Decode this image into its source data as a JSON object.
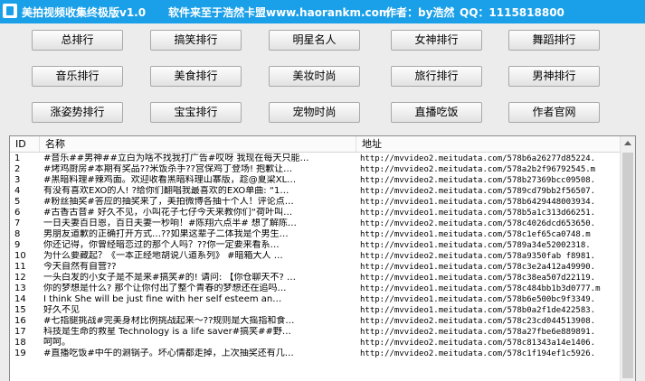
{
  "window": {
    "title_app": "美拍视频收集终极版v1.0",
    "title_source": "软件来至于浩然卡盟www.haorankm.com",
    "title_author": "作者：by浩然",
    "title_qq": "QQ：1115818800"
  },
  "buttons": [
    [
      "总排行",
      "搞笑排行",
      "明星名人",
      "女神排行",
      "舞蹈排行"
    ],
    [
      "音乐排行",
      "美食排行",
      "美妆时尚",
      "旅行排行",
      "男神排行"
    ],
    [
      "涨姿势排行",
      "宝宝排行",
      "宠物时尚",
      "直播吃饭",
      "作者官网"
    ]
  ],
  "list": {
    "columns": {
      "id": "ID",
      "name": "名称",
      "url": "地址"
    },
    "rows": [
      {
        "id": "1",
        "name": "#音乐##男神##立白为啥不找我打广告#哎呀 我现在每天只能…",
        "url": "http://mvvideo2.meitudata.com/578b6a26277d85224."
      },
      {
        "id": "2",
        "name": "#烤鸡厨房#本期有奖品??米饭杀手??宫保鸡丁登场! 抱歉让…",
        "url": "http://mvvideo2.meitudata.com/578a2b2f96792545.m"
      },
      {
        "id": "3",
        "name": "#黑暗料理#辣鸡面。欢迎收看黑暗料理山寨版，趁@夏梁XL…",
        "url": "http://mvvideo2.meitudata.com/578b27369bcc09508."
      },
      {
        "id": "4",
        "name": "有没有喜欢EXO的人! ?给你们翻唱我最喜欢的EXO单曲: “1…",
        "url": "http://mvvideo2.meitudata.com/5789cd79bb2f56507."
      },
      {
        "id": "5",
        "name": "#粉丝抽奖#答应的抽奖来了，美拍微博各抽十个人！评论点…",
        "url": "http://mvvideo1.meitudata.com/578b6429448003934."
      },
      {
        "id": "6",
        "name": "#古香古音# 好久不见，小叫花子七仔今天来教你们“荷叶叫…",
        "url": "http://mvvideo1.meitudata.com/578b5a1c313d66251."
      },
      {
        "id": "7",
        "name": "一日夫妻百日恩，百日夫妻一秒响！#陈翔六点半# 想了解陈…",
        "url": "http://mvvideo2.meitudata.com/578c4026dcd653650."
      },
      {
        "id": "8",
        "name": "男朋友道歉的正确打开方式…??如果这辈子二体我是个男生…",
        "url": "http://mvvideo1.meitudata.com/578c1ef65ca0748.m"
      },
      {
        "id": "9",
        "name": "你还记得，你曾经暗恋过的那个人吗？??你一定要来看系…",
        "url": "http://mvvideo1.meitudata.com/5789a34e52002318."
      },
      {
        "id": "10",
        "name": "为什么要藏起？《一本正经地胡说八道系列》 #暗箱大人 …",
        "url": "http://mvvideo2.meitudata.com/578a9350fab f8981."
      },
      {
        "id": "11",
        "name": "今天自然有自营??",
        "url": "http://mvvideo1.meitudata.com/578c3e2a412a49990."
      },
      {
        "id": "12",
        "name": "一头白发的小女子是不是来#搞笑#的! 请问: 【你仓聊天不? …",
        "url": "http://mvvideo1.meitudata.com/578c38ea507d22119."
      },
      {
        "id": "13",
        "name": "你的梦想是什么? 那个让你付出了整个青春的梦想还在追吗…",
        "url": "http://mvvideo1.meitudata.com/578c484bb1b3d0777.m"
      },
      {
        "id": "14",
        "name": "I think She will be just fine with her self esteem an…",
        "url": "http://mvvideo1.meitudata.com/578b6e500bc9f3349."
      },
      {
        "id": "15",
        "name": "好久不见",
        "url": "http://mvvideo1.meitudata.com/578b0a2f1de422583."
      },
      {
        "id": "16",
        "name": "#七指腿挑战#完美身材比例挑战起来～??规则是大摇指和食…",
        "url": "http://mvvideo2.meitudata.com/578c23cd044513908."
      },
      {
        "id": "17",
        "name": "科技是生命的救星 Technology is a life saver#搞笑##野…",
        "url": "http://mvvideo2.meitudata.com/578a27fbe6e889891."
      },
      {
        "id": "18",
        "name": "呵呵。",
        "url": "http://mvvideo2.meitudata.com/578c81343a14e1406."
      },
      {
        "id": "19",
        "name": "#直播吃饭#中午的涮锅子。坏心情都走掉，上次抽奖还有几…",
        "url": "http://mvvideo2.meitudata.com/578c1f194ef1c5926."
      }
    ]
  }
}
